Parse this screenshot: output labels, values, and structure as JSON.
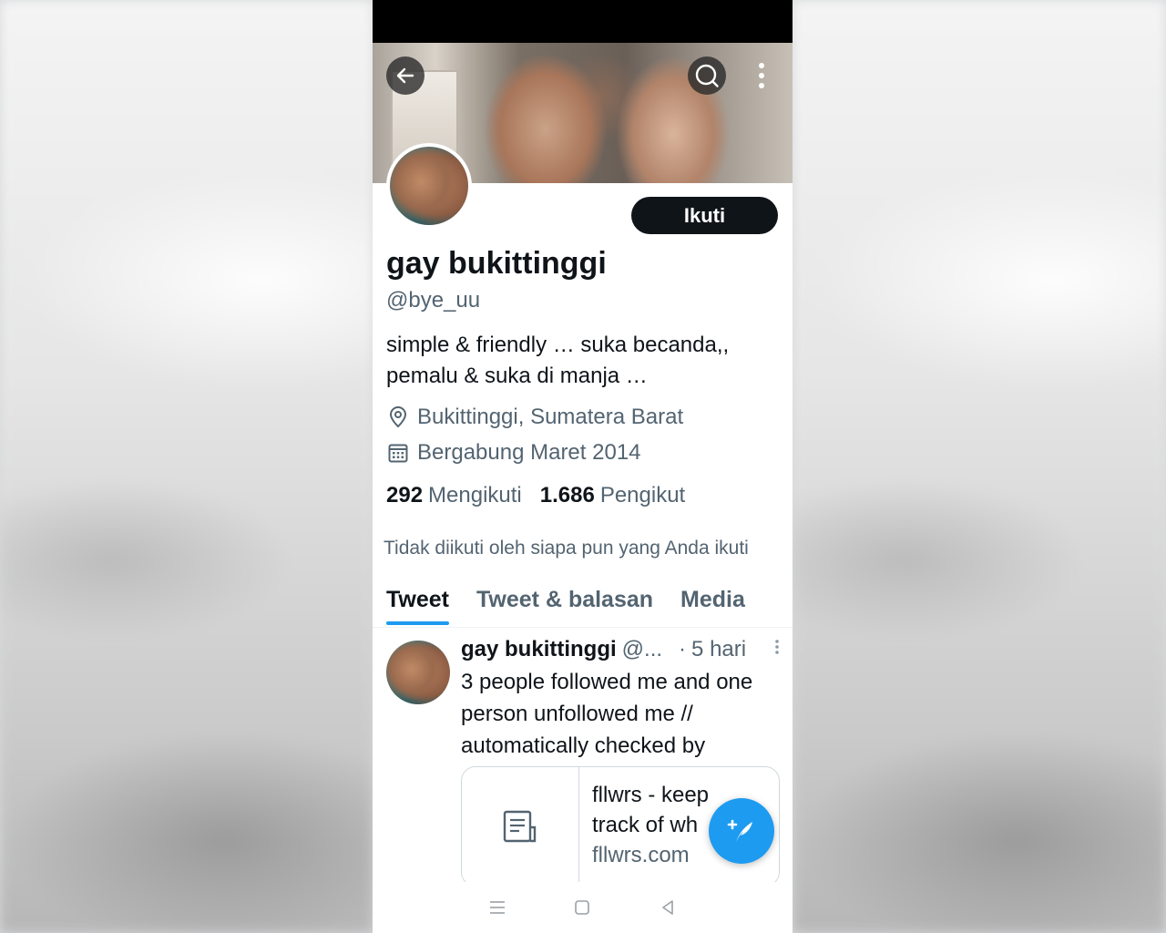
{
  "profile": {
    "display_name": "gay bukittinggi",
    "handle": "@bye_uu",
    "bio_line1": "simple & friendly … suka becanda,,",
    "bio_line2": "pemalu & suka di manja …",
    "location": "Bukittinggi, Sumatera Barat",
    "joined": "Bergabung Maret 2014",
    "following_count": "292",
    "following_label": "Mengikuti",
    "followers_count": "1.686",
    "followers_label": "Pengikut",
    "follow_button": "Ikuti",
    "not_followed_note": "Tidak diikuti oleh siapa pun yang Anda ikuti"
  },
  "tabs": [
    {
      "label": "Tweet",
      "active": true
    },
    {
      "label": "Tweet & balasan",
      "active": false
    },
    {
      "label": "Media",
      "active": false
    }
  ],
  "tweet": {
    "author_name": "gay bukittinggi",
    "author_handle": "@...",
    "separator": "·",
    "time": "5 hari",
    "text_line1": "3 people followed me and one",
    "text_line2": "person unfollowed me //",
    "text_line3": "automatically checked by",
    "card_title_line1": "fllwrs - keep",
    "card_title_line2": "track of wh",
    "card_domain": "fllwrs.com"
  },
  "icons": {
    "back": "arrow-left-icon",
    "search": "search-icon",
    "more": "more-vertical-icon",
    "location": "location-pin-icon",
    "calendar": "calendar-icon",
    "card_thumb": "document-icon",
    "compose": "compose-tweet-icon",
    "nav_menu": "menu-icon",
    "nav_home": "home-square-icon",
    "nav_back": "back-triangle-icon"
  },
  "colors": {
    "accent": "#1d9bf0",
    "text_primary": "#0f1419",
    "text_secondary": "#536471",
    "follow_button_bg": "#0f1419"
  }
}
